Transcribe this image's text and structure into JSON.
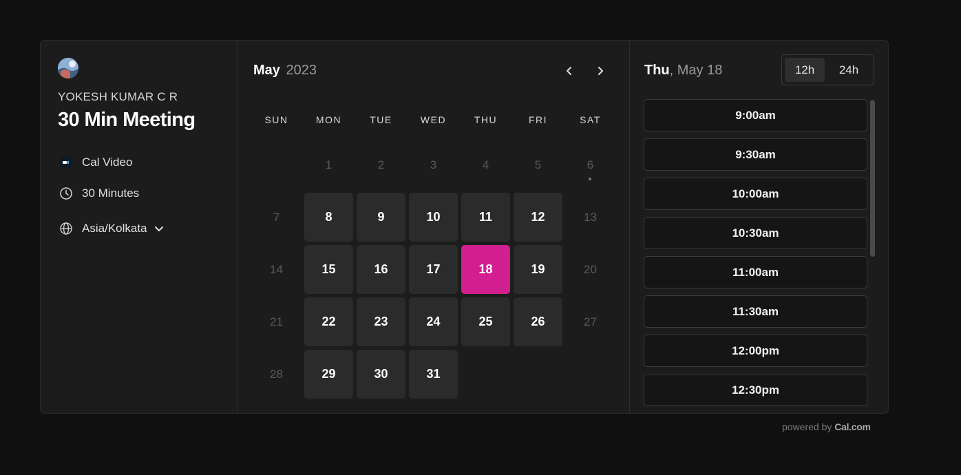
{
  "profile": {
    "host_name": "YOKESH KUMAR C R",
    "event_title": "30 Min Meeting",
    "location_icon": "cal-video-icon",
    "location": "Cal Video",
    "duration_icon": "clock-icon",
    "duration": "30 Minutes",
    "timezone_icon": "globe-icon",
    "timezone": "Asia/Kolkata"
  },
  "calendar": {
    "month": "May",
    "year": "2023",
    "weekdays": [
      "SUN",
      "MON",
      "TUE",
      "WED",
      "THU",
      "FRI",
      "SAT"
    ],
    "days": [
      {
        "label": "1",
        "state": "disabled"
      },
      {
        "label": "2",
        "state": "disabled"
      },
      {
        "label": "3",
        "state": "disabled"
      },
      {
        "label": "4",
        "state": "disabled"
      },
      {
        "label": "5",
        "state": "disabled"
      },
      {
        "label": "6",
        "state": "disabled",
        "today": true
      },
      {
        "label": "7",
        "state": "disabled"
      },
      {
        "label": "8",
        "state": "available"
      },
      {
        "label": "9",
        "state": "available"
      },
      {
        "label": "10",
        "state": "available"
      },
      {
        "label": "11",
        "state": "available"
      },
      {
        "label": "12",
        "state": "available"
      },
      {
        "label": "13",
        "state": "disabled"
      },
      {
        "label": "14",
        "state": "disabled"
      },
      {
        "label": "15",
        "state": "available"
      },
      {
        "label": "16",
        "state": "available"
      },
      {
        "label": "17",
        "state": "available"
      },
      {
        "label": "18",
        "state": "selected"
      },
      {
        "label": "19",
        "state": "available"
      },
      {
        "label": "20",
        "state": "disabled"
      },
      {
        "label": "21",
        "state": "disabled"
      },
      {
        "label": "22",
        "state": "available"
      },
      {
        "label": "23",
        "state": "available"
      },
      {
        "label": "24",
        "state": "available"
      },
      {
        "label": "25",
        "state": "available"
      },
      {
        "label": "26",
        "state": "available"
      },
      {
        "label": "27",
        "state": "disabled"
      },
      {
        "label": "28",
        "state": "disabled"
      },
      {
        "label": "29",
        "state": "available"
      },
      {
        "label": "30",
        "state": "available"
      },
      {
        "label": "31",
        "state": "available"
      }
    ],
    "first_weekday_index": 1,
    "selected_color": "#d21f8f"
  },
  "slots": {
    "day": "Thu",
    "date": ", May 18",
    "format_options": [
      "12h",
      "24h"
    ],
    "selected_format": "12h",
    "times": [
      "9:00am",
      "9:30am",
      "10:00am",
      "10:30am",
      "11:00am",
      "11:30am",
      "12:00pm",
      "12:30pm"
    ]
  },
  "footer": {
    "powered_by": "powered by",
    "brand": "Cal.com"
  }
}
